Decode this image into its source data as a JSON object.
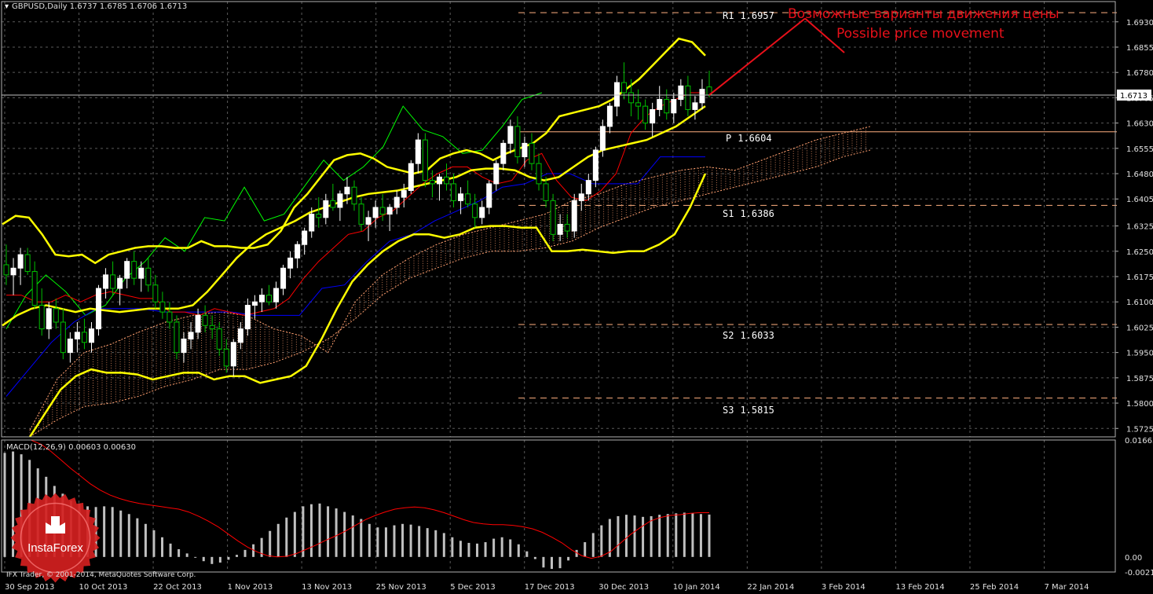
{
  "header": {
    "symbol_line": "GBPUSD,Daily  1.6737 1.6785 1.6706 1.6713"
  },
  "annotations": {
    "russian": "Возможные варианты движения цены",
    "english": "Possible price movement",
    "color": "#e8101a"
  },
  "logo": {
    "text": "InstaForex",
    "color": "#d42020"
  },
  "footer": {
    "copyright": "IFX Trader, © 2001-2014, MetaQuotes Software Corp."
  },
  "colors": {
    "background": "#000000",
    "grid": "#5a5a5a",
    "bull": "#ffffff",
    "bear": "#00c000",
    "bollinger": "#ffff00",
    "tenkan": "#ff0000",
    "kijun": "#0000ff",
    "chikou": "#00ff00",
    "cloud": "#ffa070",
    "pivot": "#ffb080",
    "macd_hist": "#c0c0c0",
    "macd_signal": "#ff0000"
  },
  "chart_data": [
    {
      "type": "line",
      "title": "GBPUSD,Daily",
      "symbol": "GBPUSD",
      "timeframe": "Daily",
      "ohlc_last": {
        "open": 1.6737,
        "high": 1.6785,
        "low": 1.6706,
        "close": 1.6713
      },
      "current_price_label": "1.6713",
      "ylim": [
        1.57,
        1.699
      ],
      "y_ticks": [
        "1.6930",
        "1.6855",
        "1.6780",
        "1.6705",
        "1.6630",
        "1.6555",
        "1.6480",
        "1.6405",
        "1.6325",
        "1.6250",
        "1.6175",
        "1.6100",
        "1.6025",
        "1.5950",
        "1.5875",
        "1.5800",
        "1.5725"
      ],
      "x_ticks": [
        "30 Sep 2013",
        "10 Oct 2013",
        "22 Oct 2013",
        "1 Nov 2013",
        "13 Nov 2013",
        "25 Nov 2013",
        "5 Dec 2013",
        "17 Dec 2013",
        "30 Dec 2013",
        "10 Jan 2014",
        "22 Jan 2014",
        "3 Feb 2014",
        "13 Feb 2014",
        "25 Feb 2014",
        "7 Mar 2014"
      ],
      "pivot_levels": [
        {
          "name": "R1",
          "value": 1.6957,
          "label": "1.6957"
        },
        {
          "name": "P",
          "value": 1.6604,
          "label": "1.6604"
        },
        {
          "name": "S1",
          "value": 1.6386,
          "label": "1.6386"
        },
        {
          "name": "S2",
          "value": 1.6033,
          "label": "1.6033"
        },
        {
          "name": "S3",
          "value": 1.5815,
          "label": "1.5815"
        }
      ],
      "candles": [
        [
          1.621,
          1.627,
          1.615,
          1.618
        ],
        [
          1.618,
          1.623,
          1.612,
          1.62
        ],
        [
          1.62,
          1.626,
          1.615,
          1.624
        ],
        [
          1.624,
          1.626,
          1.618,
          1.619
        ],
        [
          1.619,
          1.622,
          1.608,
          1.609
        ],
        [
          1.609,
          1.614,
          1.6,
          1.602
        ],
        [
          1.602,
          1.61,
          1.599,
          1.608
        ],
        [
          1.608,
          1.611,
          1.602,
          1.604
        ],
        [
          1.604,
          1.608,
          1.593,
          1.595
        ],
        [
          1.595,
          1.601,
          1.592,
          1.599
        ],
        [
          1.599,
          1.604,
          1.595,
          1.601
        ],
        [
          1.601,
          1.605,
          1.596,
          1.598
        ],
        [
          1.598,
          1.604,
          1.595,
          1.602
        ],
        [
          1.602,
          1.615,
          1.6,
          1.614
        ],
        [
          1.614,
          1.62,
          1.611,
          1.618
        ],
        [
          1.618,
          1.622,
          1.612,
          1.614
        ],
        [
          1.614,
          1.618,
          1.609,
          1.617
        ],
        [
          1.617,
          1.623,
          1.614,
          1.622
        ],
        [
          1.622,
          1.625,
          1.615,
          1.617
        ],
        [
          1.617,
          1.622,
          1.613,
          1.62
        ],
        [
          1.62,
          1.623,
          1.613,
          1.615
        ],
        [
          1.615,
          1.618,
          1.608,
          1.61
        ],
        [
          1.61,
          1.613,
          1.605,
          1.607
        ],
        [
          1.607,
          1.61,
          1.602,
          1.604
        ],
        [
          1.604,
          1.606,
          1.593,
          1.595
        ],
        [
          1.595,
          1.601,
          1.592,
          1.599
        ],
        [
          1.599,
          1.604,
          1.596,
          1.601
        ],
        [
          1.601,
          1.608,
          1.599,
          1.606
        ],
        [
          1.606,
          1.609,
          1.601,
          1.603
        ],
        [
          1.603,
          1.606,
          1.599,
          1.602
        ],
        [
          1.602,
          1.604,
          1.594,
          1.596
        ],
        [
          1.596,
          1.599,
          1.589,
          1.591
        ],
        [
          1.591,
          1.599,
          1.588,
          1.598
        ],
        [
          1.598,
          1.604,
          1.596,
          1.602
        ],
        [
          1.602,
          1.611,
          1.6,
          1.609
        ],
        [
          1.609,
          1.612,
          1.605,
          1.61
        ],
        [
          1.61,
          1.614,
          1.607,
          1.612
        ],
        [
          1.612,
          1.615,
          1.609,
          1.61
        ],
        [
          1.61,
          1.616,
          1.608,
          1.614
        ],
        [
          1.614,
          1.621,
          1.612,
          1.62
        ],
        [
          1.62,
          1.625,
          1.617,
          1.623
        ],
        [
          1.623,
          1.628,
          1.62,
          1.627
        ],
        [
          1.627,
          1.632,
          1.624,
          1.631
        ],
        [
          1.631,
          1.638,
          1.629,
          1.636
        ],
        [
          1.636,
          1.641,
          1.632,
          1.635
        ],
        [
          1.635,
          1.642,
          1.633,
          1.64
        ],
        [
          1.64,
          1.645,
          1.637,
          1.638
        ],
        [
          1.638,
          1.643,
          1.634,
          1.642
        ],
        [
          1.642,
          1.647,
          1.639,
          1.644
        ],
        [
          1.644,
          1.646,
          1.637,
          1.639
        ],
        [
          1.639,
          1.641,
          1.631,
          1.633
        ],
        [
          1.633,
          1.637,
          1.628,
          1.635
        ],
        [
          1.635,
          1.64,
          1.632,
          1.638
        ],
        [
          1.638,
          1.642,
          1.634,
          1.636
        ],
        [
          1.636,
          1.639,
          1.631,
          1.638
        ],
        [
          1.638,
          1.643,
          1.636,
          1.641
        ],
        [
          1.641,
          1.645,
          1.638,
          1.643
        ],
        [
          1.643,
          1.652,
          1.642,
          1.651
        ],
        [
          1.651,
          1.66,
          1.648,
          1.658
        ],
        [
          1.658,
          1.66,
          1.644,
          1.646
        ],
        [
          1.646,
          1.649,
          1.641,
          1.645
        ],
        [
          1.645,
          1.648,
          1.64,
          1.647
        ],
        [
          1.647,
          1.651,
          1.643,
          1.645
        ],
        [
          1.645,
          1.648,
          1.638,
          1.64
        ],
        [
          1.64,
          1.644,
          1.636,
          1.642
        ],
        [
          1.642,
          1.646,
          1.638,
          1.639
        ],
        [
          1.639,
          1.642,
          1.632,
          1.635
        ],
        [
          1.635,
          1.64,
          1.633,
          1.638
        ],
        [
          1.638,
          1.646,
          1.636,
          1.645
        ],
        [
          1.645,
          1.652,
          1.643,
          1.651
        ],
        [
          1.651,
          1.658,
          1.649,
          1.657
        ],
        [
          1.657,
          1.664,
          1.654,
          1.662
        ],
        [
          1.662,
          1.665,
          1.651,
          1.653
        ],
        [
          1.653,
          1.659,
          1.65,
          1.657
        ],
        [
          1.657,
          1.66,
          1.649,
          1.651
        ],
        [
          1.651,
          1.654,
          1.643,
          1.645
        ],
        [
          1.645,
          1.647,
          1.638,
          1.64
        ],
        [
          1.64,
          1.642,
          1.628,
          1.63
        ],
        [
          1.63,
          1.636,
          1.628,
          1.633
        ],
        [
          1.633,
          1.636,
          1.629,
          1.631
        ],
        [
          1.631,
          1.642,
          1.629,
          1.64
        ],
        [
          1.64,
          1.645,
          1.637,
          1.642
        ],
        [
          1.642,
          1.648,
          1.64,
          1.646
        ],
        [
          1.646,
          1.656,
          1.644,
          1.655
        ],
        [
          1.655,
          1.664,
          1.653,
          1.662
        ],
        [
          1.662,
          1.669,
          1.66,
          1.668
        ],
        [
          1.668,
          1.677,
          1.665,
          1.675
        ],
        [
          1.675,
          1.681,
          1.67,
          1.672
        ],
        [
          1.672,
          1.676,
          1.665,
          1.669
        ],
        [
          1.669,
          1.673,
          1.664,
          1.668
        ],
        [
          1.668,
          1.67,
          1.661,
          1.663
        ],
        [
          1.663,
          1.669,
          1.659,
          1.667
        ],
        [
          1.667,
          1.674,
          1.665,
          1.67
        ],
        [
          1.67,
          1.673,
          1.664,
          1.666
        ],
        [
          1.666,
          1.672,
          1.663,
          1.67
        ],
        [
          1.67,
          1.676,
          1.668,
          1.674
        ],
        [
          1.674,
          1.677,
          1.665,
          1.667
        ],
        [
          1.667,
          1.671,
          1.664,
          1.669
        ],
        [
          1.669,
          1.676,
          1.667,
          1.673
        ],
        [
          1.6737,
          1.6785,
          1.6706,
          1.6713
        ]
      ],
      "bollinger_upper": [
        1.633,
        1.6355,
        1.635,
        1.63,
        1.624,
        1.6235,
        1.624,
        1.6215,
        1.624,
        1.625,
        1.626,
        1.6265,
        1.6265,
        1.626,
        1.626,
        1.628,
        1.6265,
        1.6265,
        1.626,
        1.626,
        1.627,
        1.631,
        1.638,
        1.642,
        1.647,
        1.652,
        1.6535,
        1.654,
        1.6525,
        1.65,
        1.649,
        1.648,
        1.649,
        1.6525,
        1.654,
        1.655,
        1.654,
        1.652,
        1.654,
        1.6555,
        1.657,
        1.66,
        1.665,
        1.666,
        1.667,
        1.668,
        1.67,
        1.673,
        1.676,
        1.68,
        1.684,
        1.688,
        1.687,
        1.683
      ],
      "bollinger_middle": [
        1.603,
        1.606,
        1.608,
        1.609,
        1.608,
        1.607,
        1.608,
        1.6075,
        1.607,
        1.6075,
        1.608,
        1.608,
        1.608,
        1.609,
        1.613,
        1.618,
        1.623,
        1.627,
        1.63,
        1.632,
        1.634,
        1.6365,
        1.638,
        1.6395,
        1.641,
        1.642,
        1.6425,
        1.643,
        1.644,
        1.645,
        1.646,
        1.647,
        1.649,
        1.6495,
        1.6495,
        1.649,
        1.647,
        1.646,
        1.647,
        1.65,
        1.653,
        1.655,
        1.656,
        1.657,
        1.658,
        1.66,
        1.662,
        1.665,
        1.668
      ],
      "bollinger_lower": [
        1.57,
        1.577,
        1.584,
        1.588,
        1.59,
        1.589,
        1.589,
        1.5885,
        1.587,
        1.588,
        1.589,
        1.589,
        1.587,
        1.588,
        1.588,
        1.586,
        1.587,
        1.588,
        1.591,
        1.599,
        1.608,
        1.616,
        1.621,
        1.625,
        1.628,
        1.63,
        1.63,
        1.629,
        1.63,
        1.632,
        1.6325,
        1.6325,
        1.632,
        1.632,
        1.625,
        1.625,
        1.6255,
        1.625,
        1.6245,
        1.625,
        1.625,
        1.627,
        1.63,
        1.638,
        1.648
      ],
      "kumo_span_a": [
        1.572,
        1.587,
        1.595,
        1.5975,
        1.601,
        1.604,
        1.606,
        1.607,
        1.606,
        1.602,
        1.6,
        1.595,
        1.61,
        1.618,
        1.623,
        1.627,
        1.63,
        1.632,
        1.634,
        1.636,
        1.64,
        1.642,
        1.645,
        1.647,
        1.649,
        1.65,
        1.649,
        1.652,
        1.655,
        1.658,
        1.66,
        1.662
      ],
      "kumo_span_b": [
        1.57,
        1.575,
        1.579,
        1.58,
        1.582,
        1.585,
        1.587,
        1.59,
        1.59,
        1.592,
        1.595,
        1.599,
        1.605,
        1.612,
        1.617,
        1.62,
        1.623,
        1.625,
        1.625,
        1.626,
        1.628,
        1.632,
        1.635,
        1.638,
        1.64,
        1.642,
        1.644,
        1.646,
        1.648,
        1.65,
        1.653,
        1.655
      ],
      "tenkan_sen": [
        1.612,
        1.612,
        1.61,
        1.61,
        1.612,
        1.61,
        1.612,
        1.613,
        1.612,
        1.611,
        1.611,
        1.607,
        1.607,
        1.606,
        1.608,
        1.607,
        1.606,
        1.607,
        1.608,
        1.611,
        1.617,
        1.622,
        1.626,
        1.63,
        1.631,
        1.635,
        1.637,
        1.641,
        1.645,
        1.648,
        1.65,
        1.65,
        1.647,
        1.645,
        1.646,
        1.652,
        1.654,
        1.646,
        1.641,
        1.64,
        1.643,
        1.648,
        1.66,
        1.665,
        1.668,
        1.67,
        1.672,
        1.672
      ],
      "kijun_sen": [
        1.582,
        1.59,
        1.598,
        1.604,
        1.608,
        1.608,
        1.608,
        1.607,
        1.607,
        1.607,
        1.607,
        1.606,
        1.606,
        1.606,
        1.614,
        1.615,
        1.622,
        1.628,
        1.63,
        1.634,
        1.637,
        1.64,
        1.644,
        1.645,
        1.648,
        1.648,
        1.645,
        1.645,
        1.645,
        1.653,
        1.653,
        1.653
      ],
      "chikou_span": [
        1.602,
        1.612,
        1.618,
        1.613,
        1.606,
        1.609,
        1.617,
        1.622,
        1.629,
        1.625,
        1.635,
        1.634,
        1.644,
        1.634,
        1.636,
        1.644,
        1.652,
        1.646,
        1.65,
        1.656,
        1.668,
        1.661,
        1.659,
        1.654,
        1.655,
        1.662,
        1.67,
        1.672
      ],
      "arrow_projection": {
        "from": 1.6713,
        "to": 1.694
      }
    },
    {
      "type": "bar",
      "title": "MACD(12,26,9) 0.00603 0.00630",
      "indicator": "MACD(12,26,9)",
      "macd_value": 0.00603,
      "signal_value": 0.0063,
      "ylim": [
        -0.00214,
        0.01663
      ],
      "y_ticks": [
        "0.01663",
        "0.00",
        "-0.00214"
      ],
      "histogram": [
        0.0148,
        0.015,
        0.0146,
        0.0138,
        0.0126,
        0.0114,
        0.0101,
        0.009,
        0.008,
        0.0076,
        0.0072,
        0.0071,
        0.0072,
        0.0071,
        0.0066,
        0.0061,
        0.0055,
        0.0047,
        0.0038,
        0.0028,
        0.0019,
        0.0011,
        0.0005,
        0.0,
        -0.0006,
        -0.001,
        -0.0008,
        -0.0004,
        0.0003,
        0.001,
        0.0018,
        0.0027,
        0.0037,
        0.0047,
        0.0056,
        0.0064,
        0.0072,
        0.0075,
        0.0076,
        0.0072,
        0.0069,
        0.0064,
        0.0059,
        0.0054,
        0.0047,
        0.0042,
        0.0042,
        0.0045,
        0.0047,
        0.0046,
        0.0044,
        0.0041,
        0.0038,
        0.0034,
        0.0028,
        0.0023,
        0.002,
        0.0019,
        0.0021,
        0.0026,
        0.0028,
        0.0025,
        0.0018,
        0.0008,
        -0.0003,
        -0.0015,
        -0.0017,
        -0.0016,
        -0.0005,
        0.001,
        0.0021,
        0.0034,
        0.0045,
        0.0054,
        0.0058,
        0.006,
        0.0059,
        0.0057,
        0.0058,
        0.006,
        0.0061,
        0.0062,
        0.0063,
        0.0062,
        0.0061,
        0.00603
      ],
      "signal": [
        0.0166,
        0.016,
        0.015,
        0.0138,
        0.0126,
        0.0115,
        0.0104,
        0.0095,
        0.0088,
        0.0083,
        0.0079,
        0.0076,
        0.0074,
        0.0072,
        0.007,
        0.0068,
        0.0064,
        0.0058,
        0.0051,
        0.0043,
        0.0033,
        0.0023,
        0.0014,
        0.0007,
        0.0002,
        0.0,
        0.0001,
        0.0005,
        0.0011,
        0.0017,
        0.0024,
        0.003,
        0.0037,
        0.0045,
        0.0053,
        0.0059,
        0.0064,
        0.0068,
        0.007,
        0.0071,
        0.007,
        0.0067,
        0.0063,
        0.0058,
        0.0053,
        0.0049,
        0.0047,
        0.0046,
        0.0046,
        0.0045,
        0.0043,
        0.004,
        0.0035,
        0.0028,
        0.002,
        0.001,
        0.0002,
        -0.0002,
        0.0001,
        0.0008,
        0.002,
        0.0032,
        0.0042,
        0.0051,
        0.0056,
        0.0059,
        0.006,
        0.0062,
        0.0063,
        0.0063
      ]
    }
  ]
}
